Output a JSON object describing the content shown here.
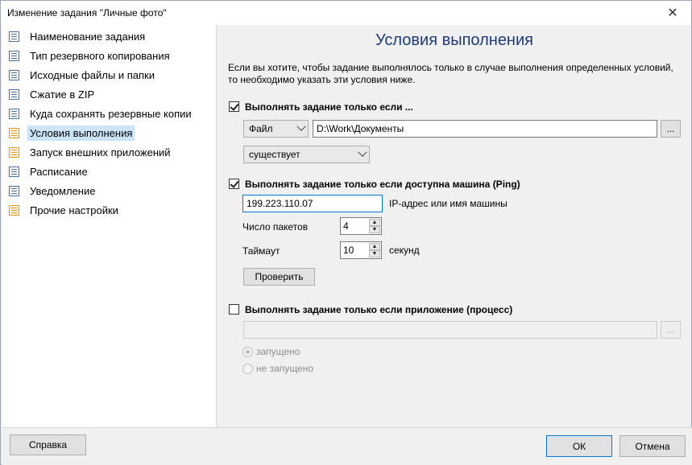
{
  "window": {
    "title": "Изменение задания \"Личные фото\""
  },
  "sidebar": {
    "items": [
      {
        "label": "Наименование задания"
      },
      {
        "label": "Тип резервного копирования"
      },
      {
        "label": "Исходные файлы и папки"
      },
      {
        "label": "Сжатие в ZIP"
      },
      {
        "label": "Куда сохранять резервные копии"
      },
      {
        "label": "Условия выполнения"
      },
      {
        "label": "Запуск внешних приложений"
      },
      {
        "label": "Расписание"
      },
      {
        "label": "Уведомление"
      },
      {
        "label": "Прочие настройки"
      }
    ]
  },
  "main": {
    "heading": "Условия выполнения",
    "intro": "Если вы хотите, чтобы задание выполнялось только в случае выполнения определенных условий, то необходимо указать эти условия ниже.",
    "cond1": {
      "label": "Выполнять задание только если ...",
      "type_value": "Файл",
      "path_value": "D:\\Work\\Документы",
      "browse_label": "...",
      "state_value": "существует"
    },
    "cond2": {
      "label": "Выполнять задание только если доступна машина (Ping)",
      "ip_value": "199.223.110.07",
      "ip_hint": "IP-адрес или имя машины",
      "packets_label": "Число пакетов",
      "packets_value": "4",
      "timeout_label": "Таймаут",
      "timeout_value": "10",
      "timeout_unit": "секунд",
      "check_button": "Проверить"
    },
    "cond3": {
      "label": "Выполнять задание только если приложение (процесс)",
      "app_value": "",
      "browse_label": "...",
      "running_label": "запущено",
      "not_running_label": "не запущено"
    }
  },
  "footer": {
    "help_button": "Справка",
    "ok_button": "ОК",
    "cancel_button": "Отмена"
  }
}
